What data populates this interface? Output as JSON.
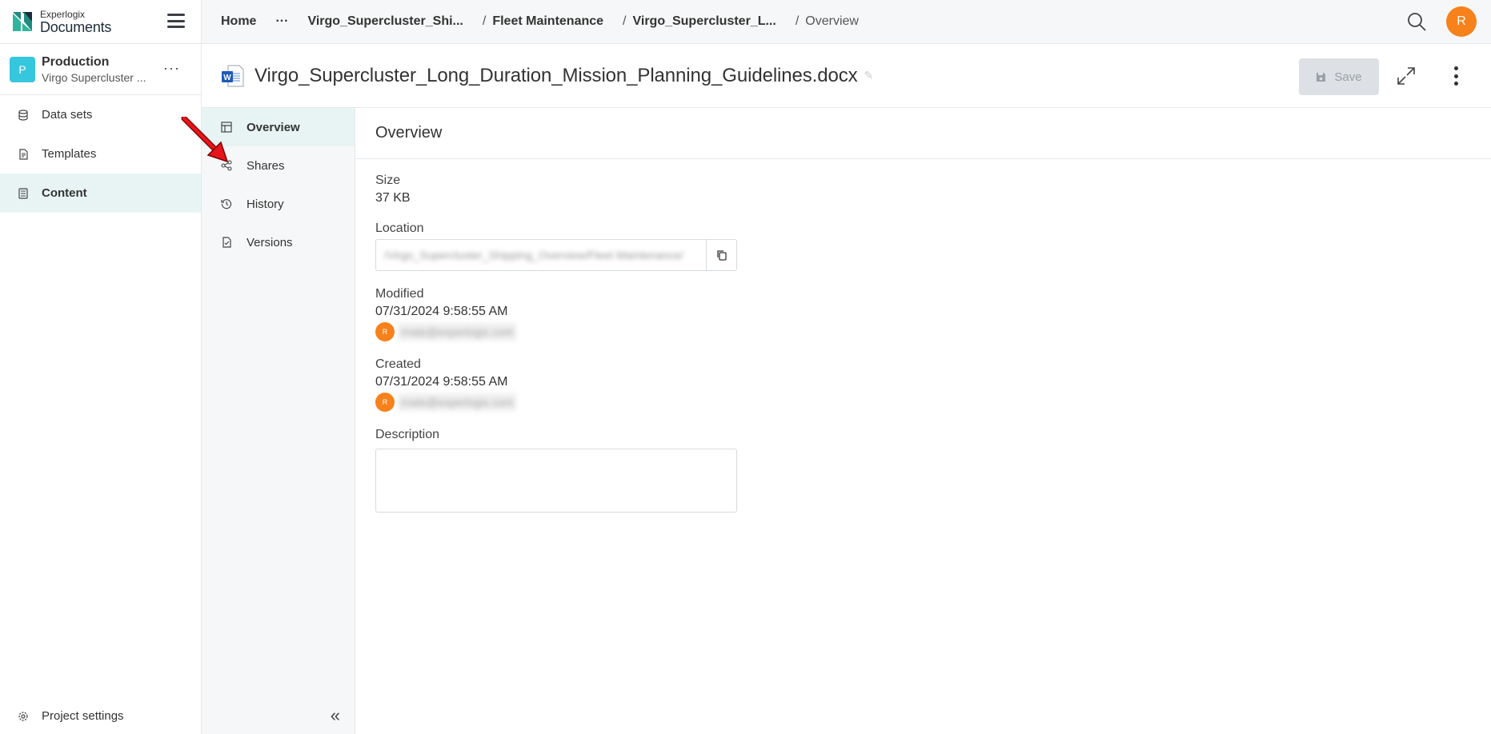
{
  "app": {
    "logo_small": "Experlogix",
    "logo_big": "Documents"
  },
  "project": {
    "badge": "P",
    "name": "Production",
    "subtitle": "Virgo Supercluster ..."
  },
  "sidebar": {
    "items": [
      {
        "label": "Data sets",
        "icon": "database-icon",
        "active": false
      },
      {
        "label": "Templates",
        "icon": "template-file-icon",
        "active": false
      },
      {
        "label": "Content",
        "icon": "content-icon",
        "active": true
      }
    ],
    "settings_label": "Project settings"
  },
  "breadcrumb": {
    "home": "Home",
    "ellipsis": "···",
    "item1": "Virgo_Supercluster_Shi...",
    "item2": "Fleet Maintenance",
    "item3": "Virgo_Supercluster_L...",
    "current": "Overview"
  },
  "user": {
    "initial": "R",
    "color": "#f7811a"
  },
  "document": {
    "title": "Virgo_Supercluster_Long_Duration_Mission_Planning_Guidelines.docx",
    "save_label": "Save"
  },
  "subnav": {
    "items": [
      {
        "label": "Overview",
        "icon": "table-icon",
        "active": true
      },
      {
        "label": "Shares",
        "icon": "share-icon",
        "active": false
      },
      {
        "label": "History",
        "icon": "history-icon",
        "active": false
      },
      {
        "label": "Versions",
        "icon": "versions-icon",
        "active": false
      }
    ],
    "collapse_glyph": "«"
  },
  "overview": {
    "title": "Overview",
    "size_label": "Size",
    "size_value": "37 KB",
    "location_label": "Location",
    "location_value": "/Virgo_Supercluster_Shipping_Overview/Fleet Maintenance/",
    "modified_label": "Modified",
    "modified_value": "07/31/2024 9:58:55 AM",
    "modified_user_initial": "R",
    "modified_user": "rnate@experlogix.com",
    "created_label": "Created",
    "created_value": "07/31/2024 9:58:55 AM",
    "created_user_initial": "R",
    "created_user": "rnate@experlogix.com",
    "description_label": "Description"
  },
  "colors": {
    "accent": "#36c6dd",
    "active_bg": "#e8f4f3",
    "avatar": "#f7811a",
    "annotation_arrow": "#e8141b"
  }
}
